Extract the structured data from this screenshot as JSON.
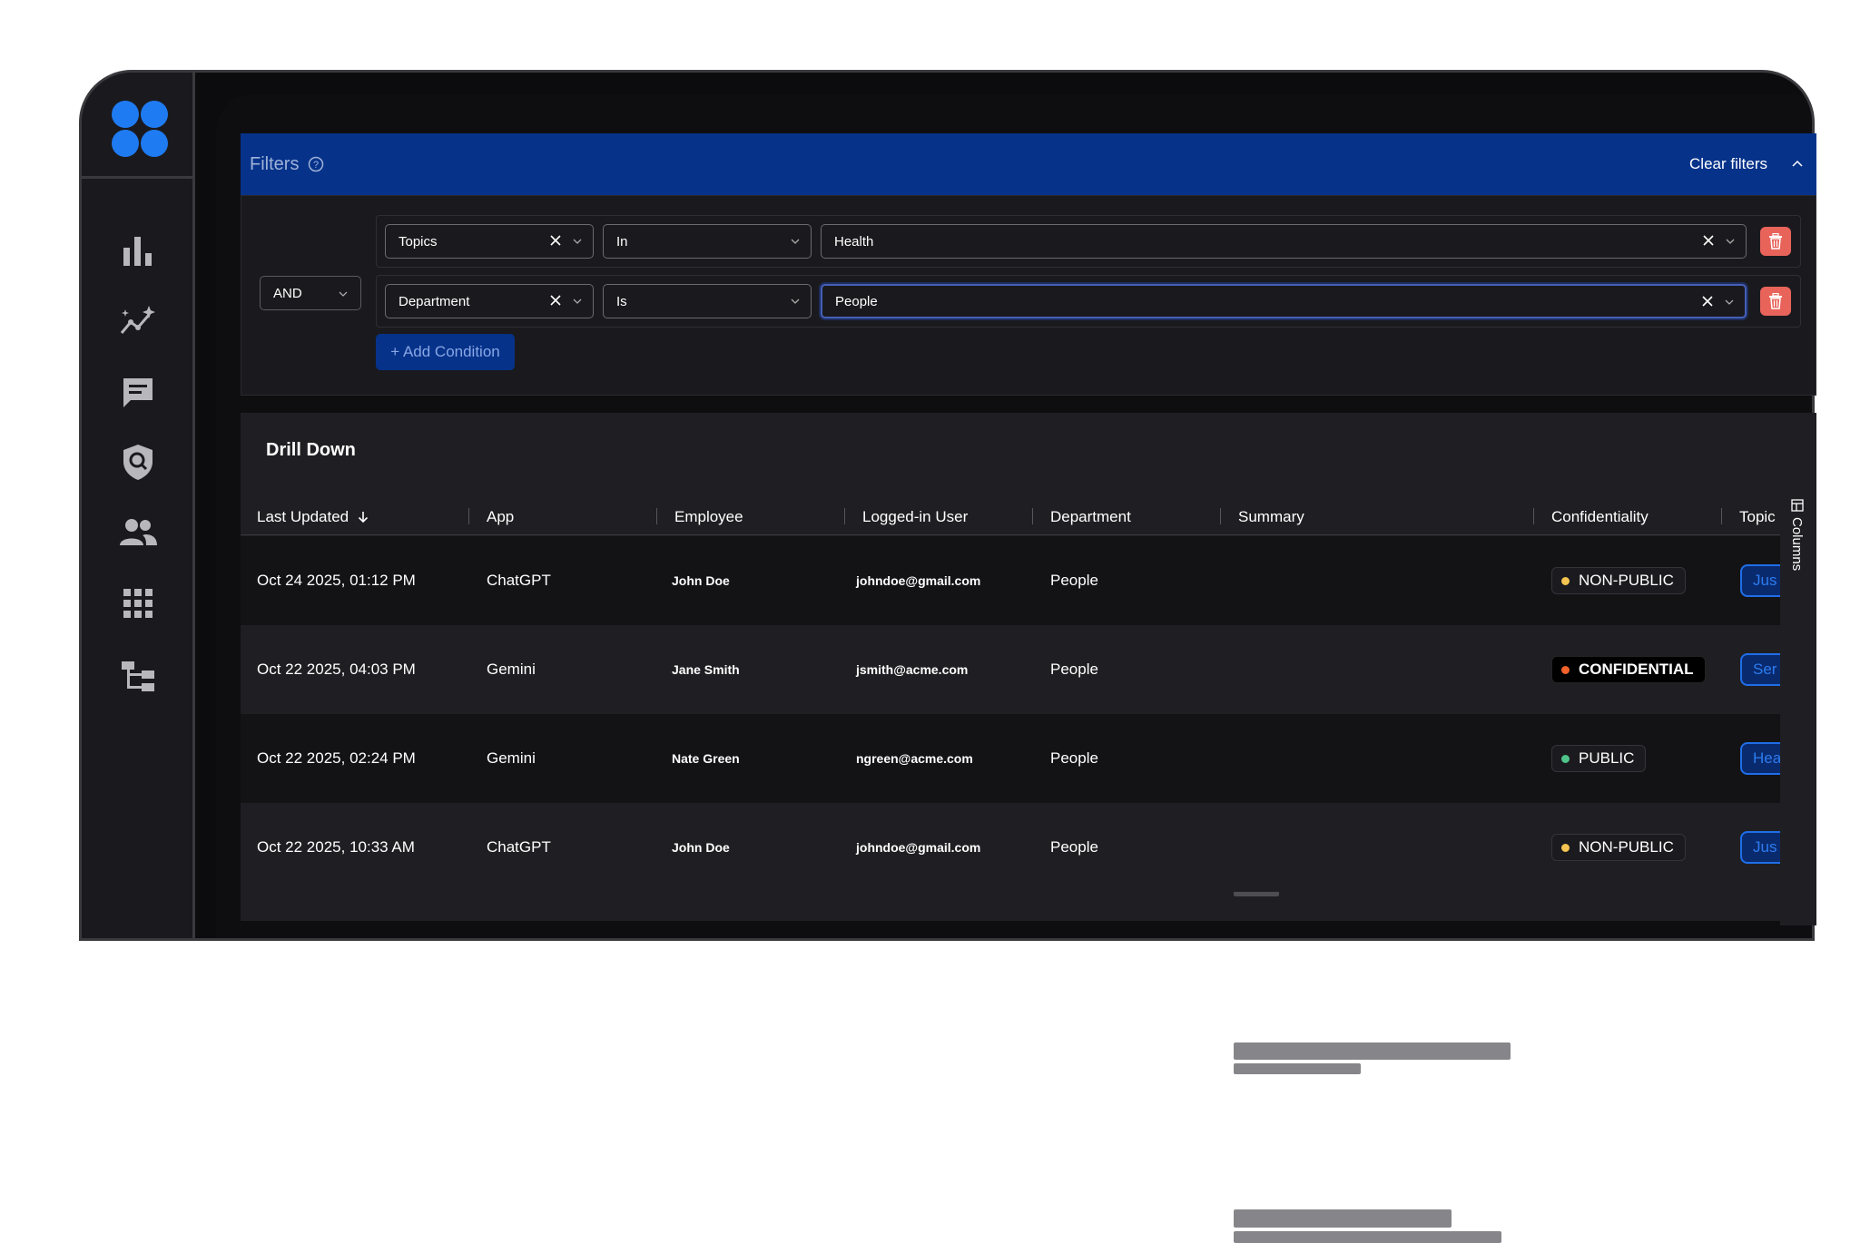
{
  "colors": {
    "accent": "#06328a",
    "logo": "#1f7bf2",
    "danger": "#e8645b",
    "non_public_dot": "#f5c451",
    "confidential_dot": "#f2622a",
    "public_dot": "#4fc38a"
  },
  "sidebar": {
    "items": [
      {
        "icon": "bar-chart-icon"
      },
      {
        "icon": "sparkle-trend-icon"
      },
      {
        "icon": "chat-icon"
      },
      {
        "icon": "shield-search-icon"
      },
      {
        "icon": "people-icon"
      },
      {
        "icon": "apps-grid-icon"
      },
      {
        "icon": "hierarchy-icon"
      }
    ]
  },
  "filters": {
    "title": "Filters",
    "clear_label": "Clear filters",
    "logic_operator": "AND",
    "add_condition_label": "+ Add Condition",
    "conditions": [
      {
        "field": "Topics",
        "operator": "In",
        "value": "Health"
      },
      {
        "field": "Department",
        "operator": "Is",
        "value": "People"
      }
    ]
  },
  "drill_down": {
    "title": "Drill Down",
    "columns_label": "Columns",
    "headers": [
      "Last Updated",
      "App",
      "Employee",
      "Logged-in User",
      "Department",
      "Summary",
      "Confidentiality",
      "Topic"
    ],
    "rows": [
      {
        "last_updated": "Oct 24 2025, 01:12 PM",
        "app": "ChatGPT",
        "employee": "John Doe",
        "user": "johndoe@gmail.com",
        "department": "People",
        "confidentiality": "NON-PUBLIC",
        "topic": "Jus"
      },
      {
        "last_updated": "Oct 22 2025, 04:03 PM",
        "app": "Gemini",
        "employee": "Jane Smith",
        "user": "jsmith@acme.com",
        "department": "People",
        "confidentiality": "CONFIDENTIAL",
        "topic": "Ser"
      },
      {
        "last_updated": "Oct 22 2025, 02:24 PM",
        "app": "Gemini",
        "employee": "Nate Green",
        "user": "ngreen@acme.com",
        "department": "People",
        "confidentiality": "PUBLIC",
        "topic": "Hea"
      },
      {
        "last_updated": "Oct 22 2025, 10:33 AM",
        "app": "ChatGPT",
        "employee": "John Doe",
        "user": "johndoe@gmail.com",
        "department": "People",
        "confidentiality": "NON-PUBLIC",
        "topic": "Jus"
      }
    ]
  }
}
